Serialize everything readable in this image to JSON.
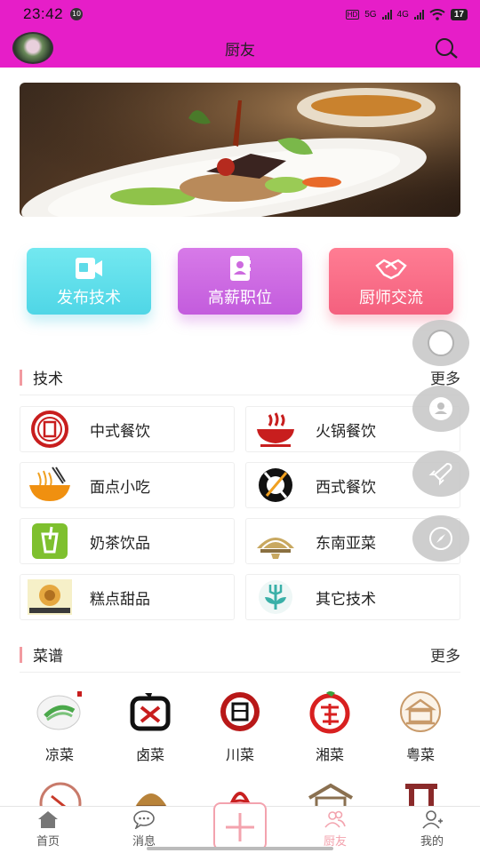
{
  "status_bar": {
    "time": "23:42",
    "notif_badge": "10",
    "net1": "HD",
    "net2": "5G",
    "net3": "4G",
    "battery": "17"
  },
  "header": {
    "title": "厨友"
  },
  "quick_actions": [
    {
      "label": "发布技术",
      "icon": "video-icon"
    },
    {
      "label": "高薪职位",
      "icon": "contact-book-icon"
    },
    {
      "label": "厨师交流",
      "icon": "handshake-icon"
    }
  ],
  "tech_section": {
    "title": "技术",
    "more": "更多",
    "categories": [
      {
        "label": "中式餐饮"
      },
      {
        "label": "火锅餐饮"
      },
      {
        "label": "面点小吃"
      },
      {
        "label": "西式餐饮"
      },
      {
        "label": "奶茶饮品"
      },
      {
        "label": "东南亚菜"
      },
      {
        "label": "糕点甜品"
      },
      {
        "label": "其它技术"
      }
    ]
  },
  "recipe_section": {
    "title": "菜谱",
    "more": "更多",
    "items": [
      {
        "label": "凉菜"
      },
      {
        "label": "卤菜"
      },
      {
        "label": "川菜"
      },
      {
        "label": "湘菜"
      },
      {
        "label": "粤菜"
      }
    ]
  },
  "floating_buttons": [
    "circle-icon",
    "user-icon",
    "rocket-icon",
    "compass-icon"
  ],
  "tab_bar": {
    "items": [
      {
        "label": "首页",
        "icon": "home-icon"
      },
      {
        "label": "消息",
        "icon": "message-icon"
      },
      {
        "label": "厨友",
        "icon": "users-icon",
        "active": true
      },
      {
        "label": "我的",
        "icon": "profile-icon"
      }
    ],
    "active_color": "#f3a3ae"
  },
  "colors": {
    "brand": "#e61ec8"
  }
}
